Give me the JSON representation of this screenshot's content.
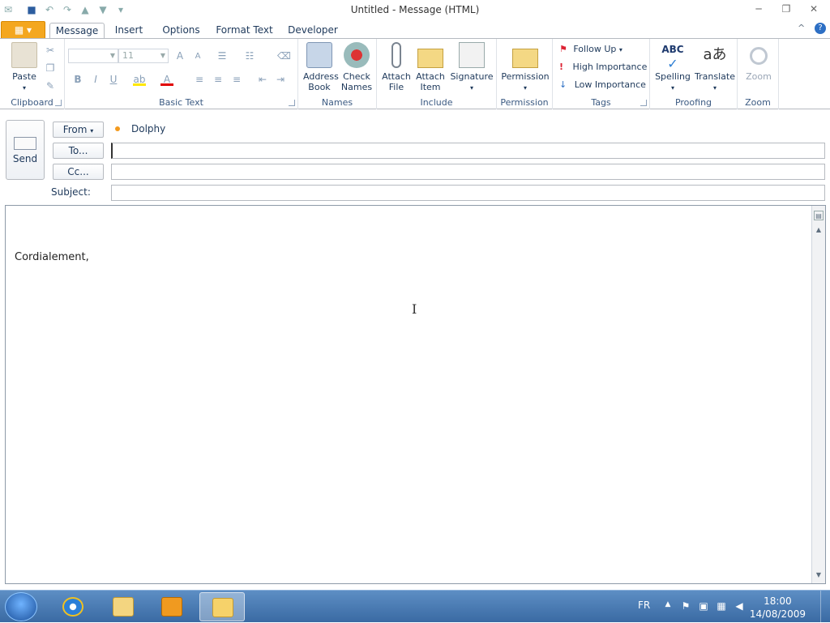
{
  "window": {
    "title": "Untitled  -  Message (HTML)"
  },
  "tabs": [
    {
      "label": "Message"
    },
    {
      "label": "Insert"
    },
    {
      "label": "Options"
    },
    {
      "label": "Format Text"
    },
    {
      "label": "Developer"
    }
  ],
  "ribbon": {
    "clipboard": {
      "label": "Clipboard",
      "paste": "Paste"
    },
    "basic_text": {
      "label": "Basic Text",
      "font_size": "11"
    },
    "names": {
      "label": "Names",
      "address_book": "Address Book",
      "check_names": "Check Names"
    },
    "include": {
      "label": "Include",
      "attach_file": "Attach File",
      "attach_item": "Attach Item",
      "signature": "Signature"
    },
    "permission": {
      "label": "Permission",
      "permission_btn": "Permission"
    },
    "tags": {
      "label": "Tags",
      "follow_up": "Follow Up",
      "high_importance": "High Importance",
      "low_importance": "Low Importance"
    },
    "proofing": {
      "label": "Proofing",
      "spelling": "Spelling",
      "translate": "Translate"
    },
    "zoom": {
      "label": "Zoom",
      "zoom_btn": "Zoom"
    }
  },
  "header": {
    "send": "Send",
    "from": "From",
    "from_name": "Dolphy",
    "to": "To...",
    "cc": "Cc...",
    "subject_label": "Subject:",
    "to_value": "",
    "cc_value": "",
    "subject_value": ""
  },
  "body": {
    "text": "Cordialement,"
  },
  "taskbar": {
    "language": "FR",
    "time": "18:00",
    "date": "14/08/2009"
  },
  "colors": {
    "file_tab": "#f4a71f",
    "presence": "#f39a1e",
    "taskbar": "#3a6aa3"
  }
}
